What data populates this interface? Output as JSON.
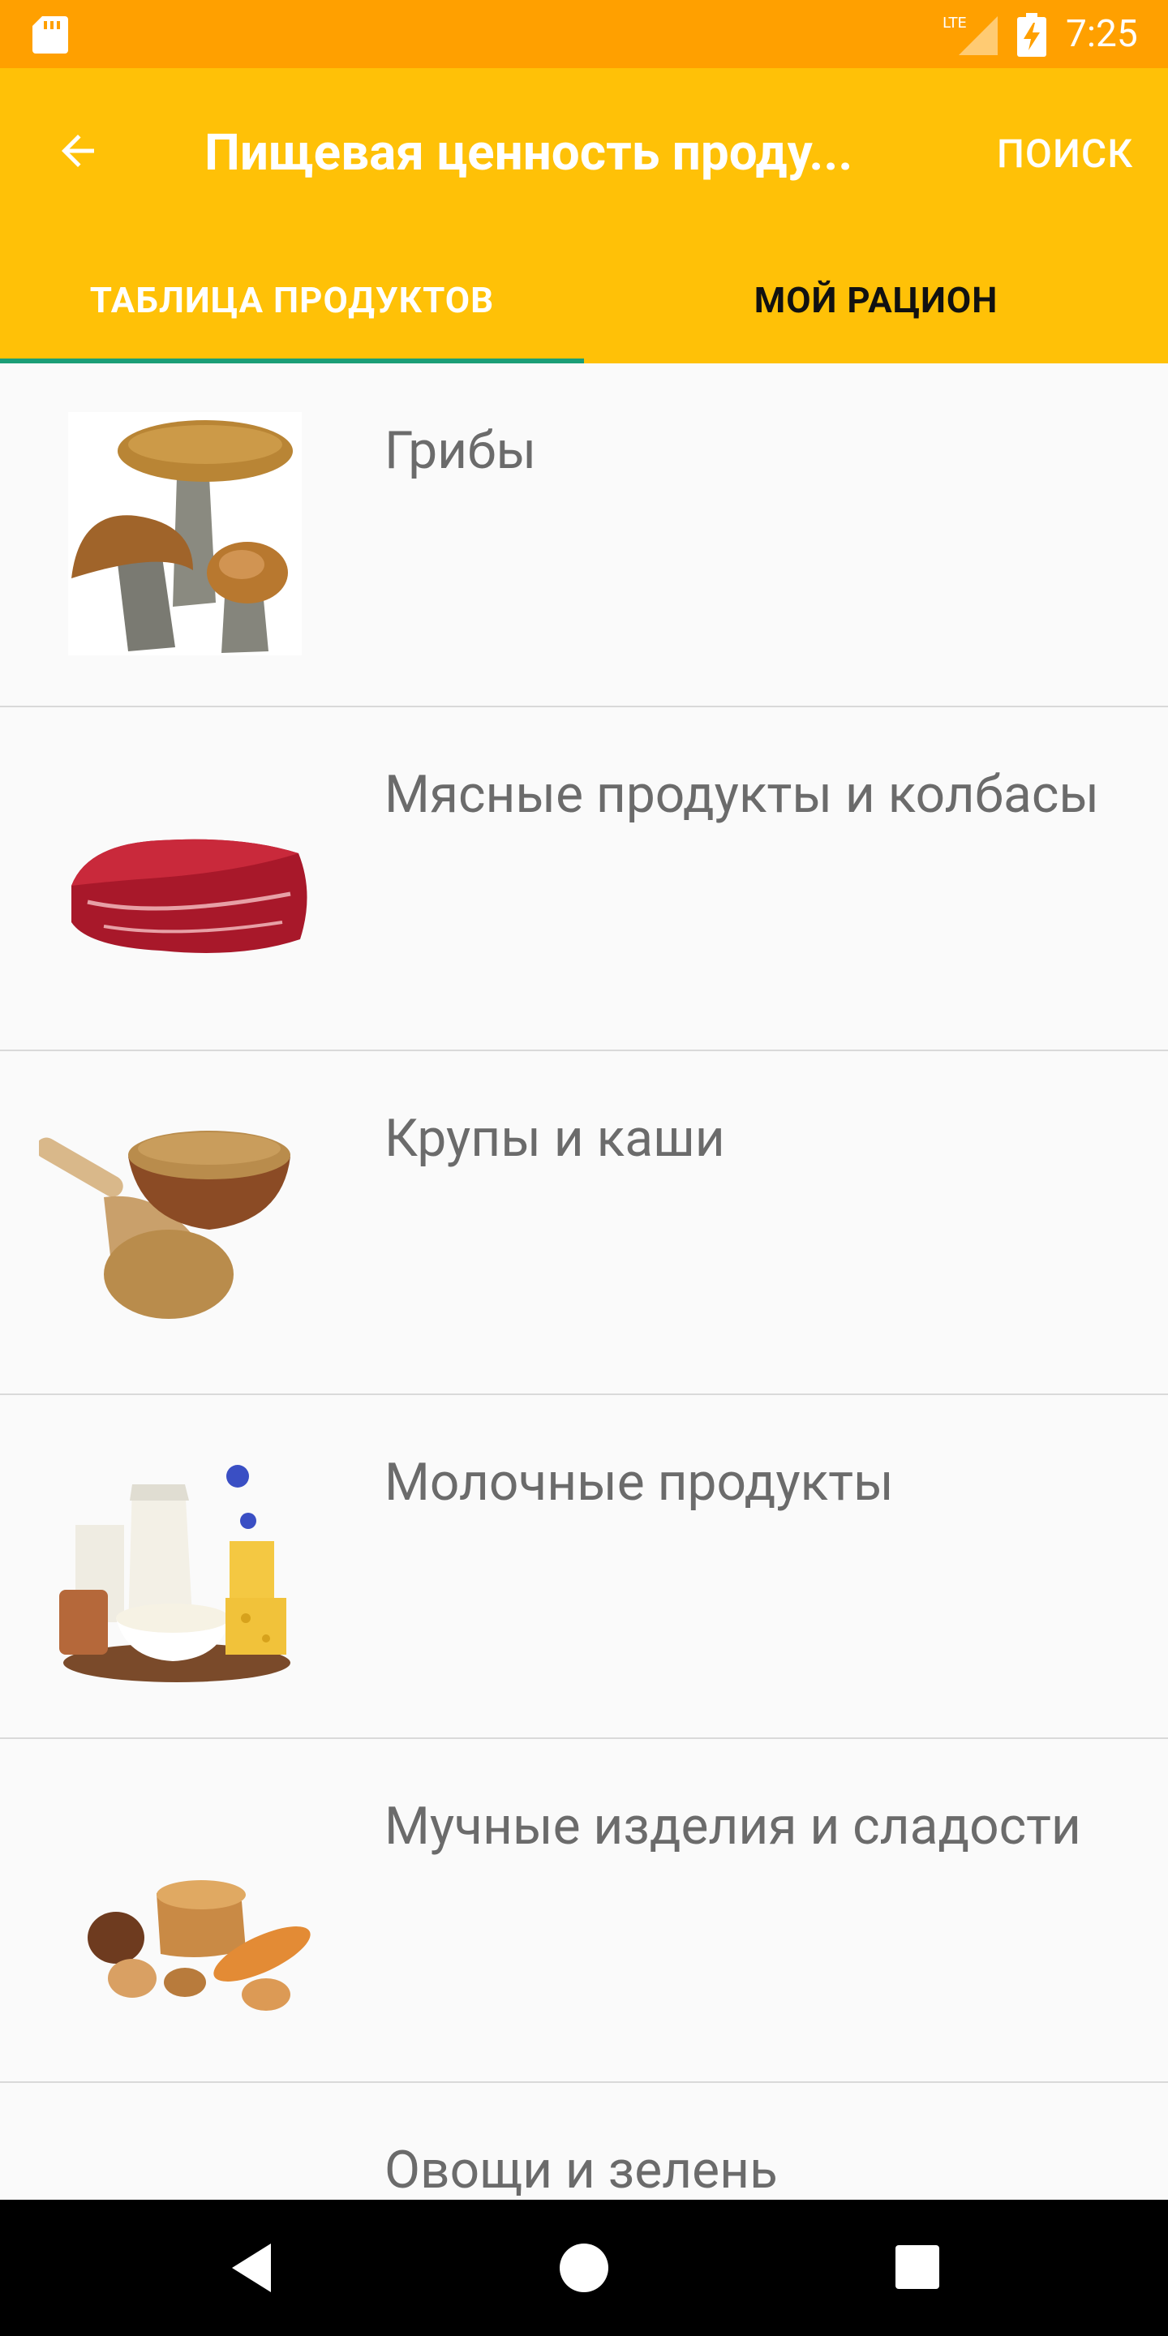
{
  "status_bar": {
    "time": "7:25",
    "network": "LTE"
  },
  "app_bar": {
    "title": "Пищевая ценность проду...",
    "search_label": "ПОИСК",
    "back_icon": "arrow-back-icon"
  },
  "tabs": [
    {
      "label": "ТАБЛИЦА ПРОДУКТОВ",
      "selected": true
    },
    {
      "label": "МОЙ РАЦИОН",
      "selected": false
    }
  ],
  "categories": [
    {
      "label": "Грибы",
      "image": "mushrooms"
    },
    {
      "label": "Мясные продукты и колбасы",
      "image": "meat"
    },
    {
      "label": "Крупы и каши",
      "image": "grains"
    },
    {
      "label": "Молочные продукты",
      "image": "dairy"
    },
    {
      "label": "Мучные изделия и сладости",
      "image": "bread"
    },
    {
      "label": "Овощи и зелень",
      "image": "vegetables"
    }
  ],
  "colors": {
    "status_bar": "#ffa000",
    "app_bar": "#ffc107",
    "tab_indicator": "#1b9e77"
  }
}
